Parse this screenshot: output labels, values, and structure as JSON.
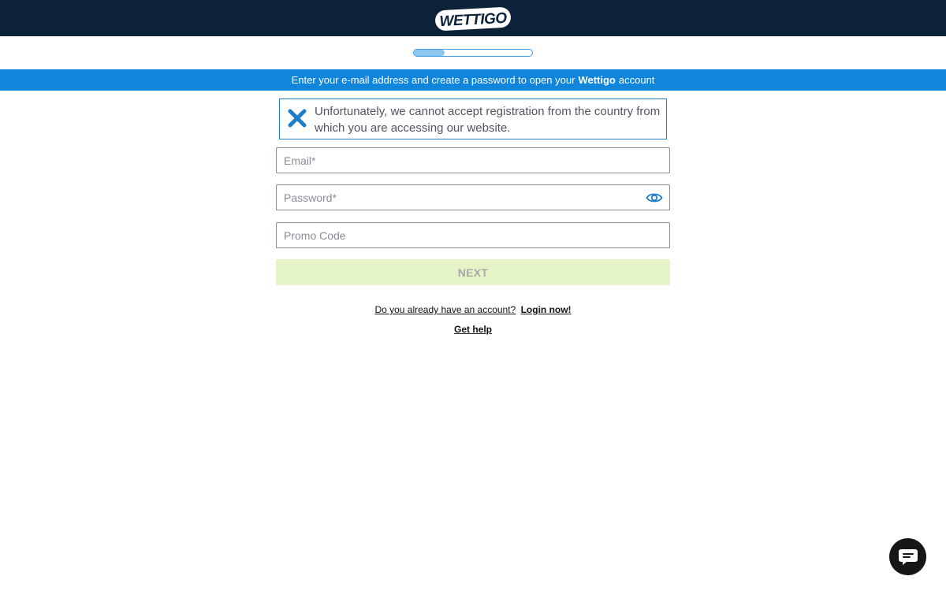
{
  "header": {
    "logo_text": "WETTIGO"
  },
  "progress": {
    "value": 0.26
  },
  "info_band": {
    "text_before": "Enter your e-mail address and create a password to open your",
    "brand": "Wettigo",
    "text_after": "account"
  },
  "error": {
    "message": "Unfortunately, we cannot accept registration from the country from which you are accessing our website."
  },
  "form": {
    "email_placeholder": "Email*",
    "password_placeholder": "Password*",
    "promo_placeholder": "Promo Code",
    "next_label": "NEXT"
  },
  "links": {
    "login_question": "Do you already have an account?",
    "login_link": "Login now!",
    "help_link": "Get help"
  },
  "icons": {
    "error": "close-x-icon",
    "password_toggle": "eye-icon",
    "chat": "chat-bubble-icon"
  },
  "colors": {
    "header_bg": "#0b2238",
    "info_band_bg": "#0f86dc",
    "accent_blue": "#1e7ec8",
    "next_button_bg": "#e6f5c8"
  }
}
